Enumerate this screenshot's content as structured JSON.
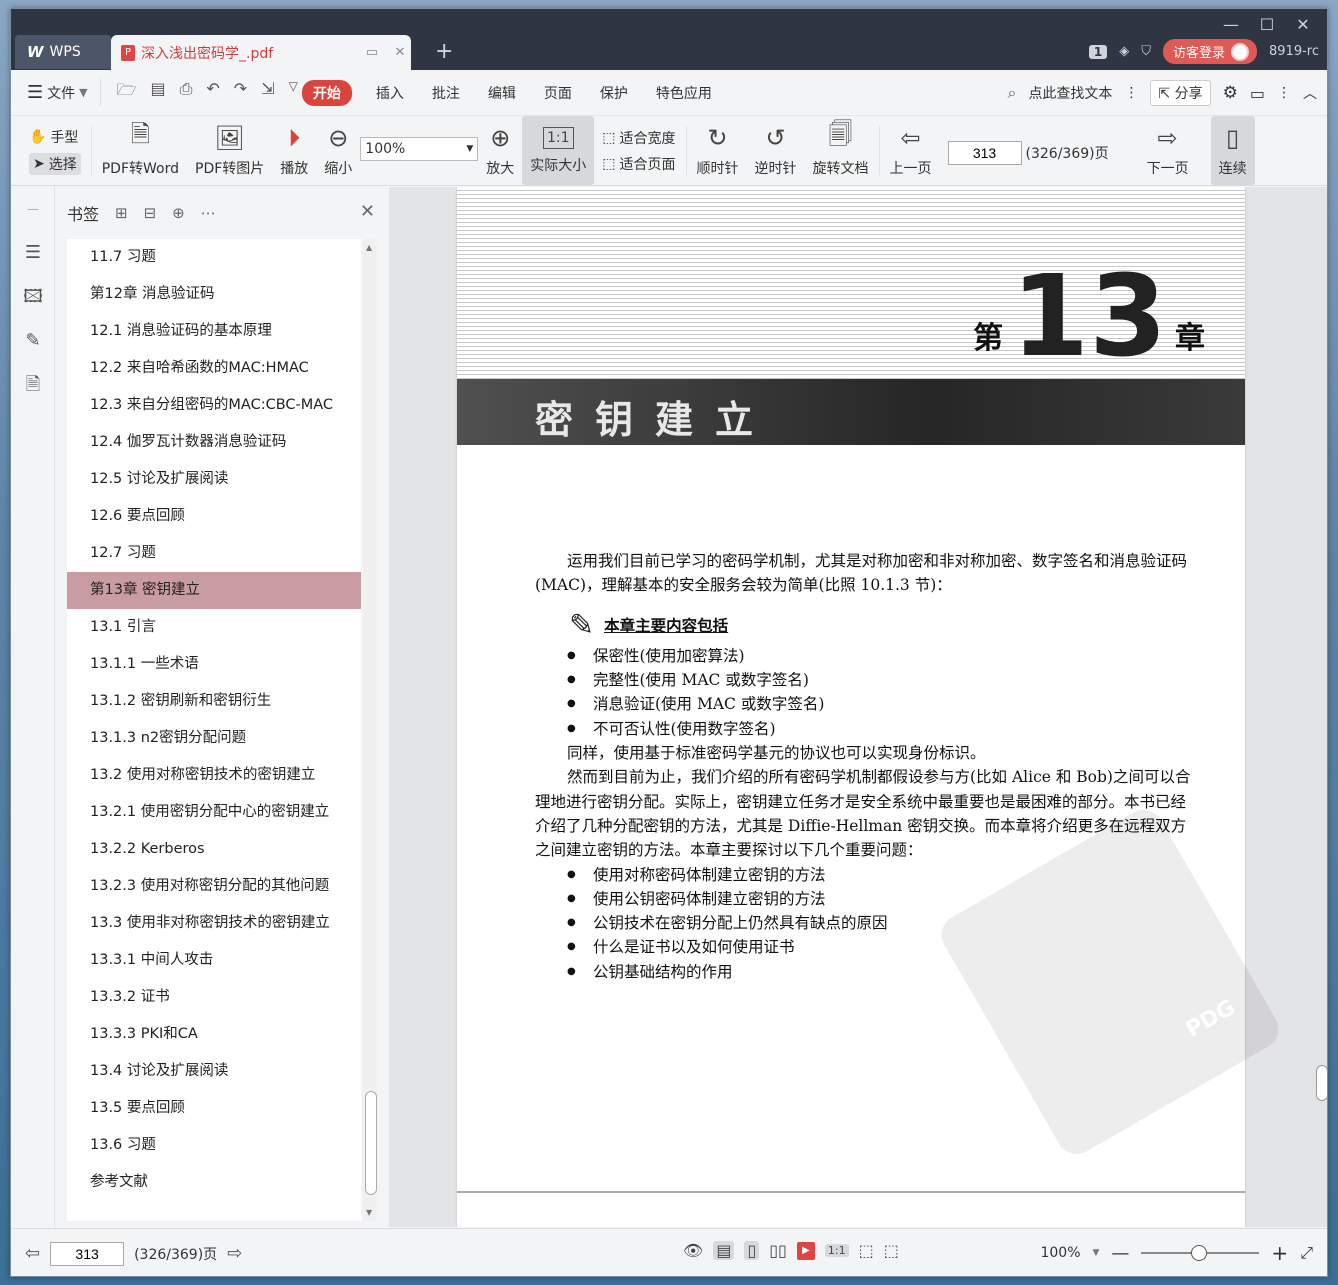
{
  "titlebar": {
    "app_tab": "WPS",
    "doc_tab": "深入浅出密码学_.pdf",
    "badge": "1",
    "login_label": "访客登录",
    "version": "8919-rc"
  },
  "menubar": {
    "file_label": "文件",
    "tabs": [
      "开始",
      "插入",
      "批注",
      "编辑",
      "页面",
      "保护",
      "特色应用"
    ],
    "active_tab": "开始",
    "search_label": "点此查找文本",
    "share_label": "分享"
  },
  "ribbon": {
    "hand": "手型",
    "select": "选择",
    "pdf2word": "PDF转Word",
    "pdf2img": "PDF转图片",
    "play": "播放",
    "zoom_out": "缩小",
    "zoom_value": "100%",
    "zoom_in": "放大",
    "actual_size": "实际大小",
    "fit_width": "适合宽度",
    "fit_page": "适合页面",
    "clockwise": "顺时针",
    "counter": "逆时针",
    "rotate_doc": "旋转文档",
    "prev_page": "上一页",
    "page_current": "313",
    "page_total": "(326/369)页",
    "next_page": "下一页",
    "continuous": "连续"
  },
  "bookmark": {
    "title": "书签",
    "items": [
      "11.7  习题",
      "第12章  消息验证码",
      "12.1  消息验证码的基本原理",
      "12.2  来自哈希函数的MAC:HMAC",
      "12.3  来自分组密码的MAC:CBC-MAC",
      "12.4  伽罗瓦计数器消息验证码",
      "12.5  讨论及扩展阅读",
      "12.6  要点回顾",
      "12.7  习题",
      "第13章  密钥建立",
      "13.1  引言",
      "13.1.1  一些术语",
      "13.1.2  密钥刷新和密钥衍生",
      "13.1.3  n2密钥分配问题",
      "13.2  使用对称密钥技术的密钥建立",
      "13.2.1  使用密钥分配中心的密钥建立",
      "13.2.2  Kerberos",
      "13.2.3  使用对称密钥分配的其他问题",
      "13.3  使用非对称密钥技术的密钥建立",
      "13.3.1  中间人攻击",
      "13.3.2  证书",
      "13.3.3  PKI和CA",
      "13.4  讨论及扩展阅读",
      "13.5  要点回顾",
      "13.6  习题",
      "参考文献"
    ],
    "selected_index": 9
  },
  "page": {
    "chapter_prefix": "第",
    "chapter_number": "13",
    "chapter_suffix": "章",
    "chapter_title": "密钥建立",
    "intro": "运用我们目前已学习的密码学机制，尤其是对称加密和非对称加密、数字签名和消息验证码(MAC)，理解基本的安全服务会较为简单(比照 10.1.3 节)：",
    "summary_title": "本章主要内容包括",
    "bullets1": [
      "保密性(使用加密算法)",
      "完整性(使用 MAC 或数字签名)",
      "消息验证(使用 MAC 或数字签名)",
      "不可否认性(使用数字签名)"
    ],
    "para2": "同样，使用基于标准密码学基元的协议也可以实现身份标识。",
    "para3": "然而到目前为止，我们介绍的所有密码学机制都假设参与方(比如 Alice 和 Bob)之间可以合理地进行密钥分配。实际上，密钥建立任务才是安全系统中最重要也是最困难的部分。本书已经介绍了几种分配密钥的方法，尤其是 Diffie-Hellman 密钥交换。而本章将介绍更多在远程双方之间建立密钥的方法。本章主要探讨以下几个重要问题：",
    "bullets2": [
      "使用对称密码体制建立密钥的方法",
      "使用公钥密码体制建立密钥的方法",
      "公钥技术在密钥分配上仍然具有缺点的原因",
      "什么是证书以及如何使用证书",
      "公钥基础结构的作用"
    ],
    "stamp_text": "PDG"
  },
  "statusbar": {
    "page_current": "313",
    "page_total": "(326/369)页",
    "zoom": "100%"
  }
}
